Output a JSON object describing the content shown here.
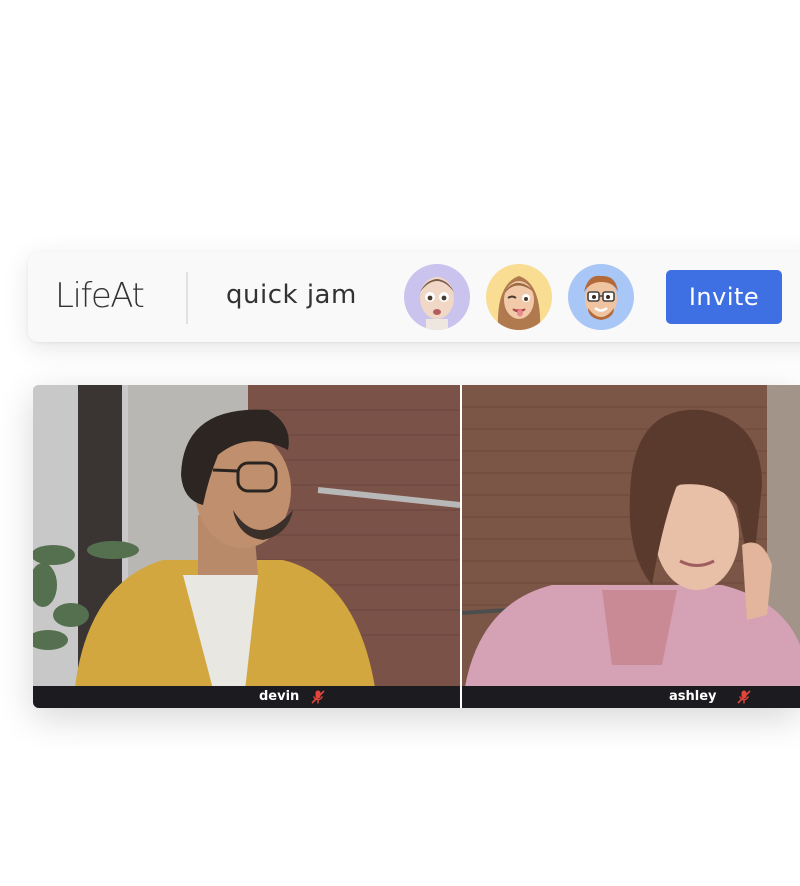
{
  "toolbar": {
    "logo": "LifeAt",
    "room_name": "quick jam",
    "invite_label": "Invite",
    "avatars": [
      {
        "icon": "memoji-man-bald-avatar",
        "bg": "#c9c3ee"
      },
      {
        "icon": "memoji-woman-winking-avatar",
        "bg": "#f8dd93"
      },
      {
        "icon": "memoji-man-glasses-avatar",
        "bg": "#a9c7f6"
      }
    ],
    "invite_color": "#3e6fe3"
  },
  "participants": [
    {
      "name": "devin",
      "mic": "mic-muted-icon"
    },
    {
      "name": "ashley",
      "mic": "mic-muted-icon"
    }
  ],
  "colors": {
    "muted_icon": "#e2453a",
    "caption_bg": "#1c1c20"
  }
}
